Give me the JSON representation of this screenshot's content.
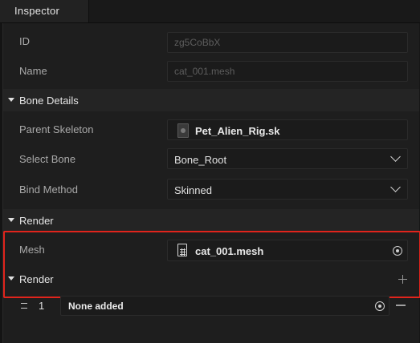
{
  "tab": {
    "title": "Inspector"
  },
  "fields": {
    "id": {
      "label": "ID",
      "value": "zg5CoBbX"
    },
    "name": {
      "label": "Name",
      "value": "cat_001.mesh"
    }
  },
  "bone_details": {
    "title": "Bone Details",
    "parent_skeleton": {
      "label": "Parent Skeleton",
      "value": "Pet_Alien_Rig.sk"
    },
    "select_bone": {
      "label": "Select Bone",
      "value": "Bone_Root"
    },
    "bind_method": {
      "label": "Bind Method",
      "value": "Skinned"
    }
  },
  "render_section": {
    "title": "Render",
    "mesh": {
      "label": "Mesh",
      "value": "cat_001.mesh"
    }
  },
  "render_list": {
    "title": "Render",
    "items": [
      {
        "index": "1",
        "value": "None added"
      }
    ]
  },
  "colors": {
    "highlight": "#e0241c",
    "panel": "#1e1e1e",
    "header": "#242424"
  }
}
